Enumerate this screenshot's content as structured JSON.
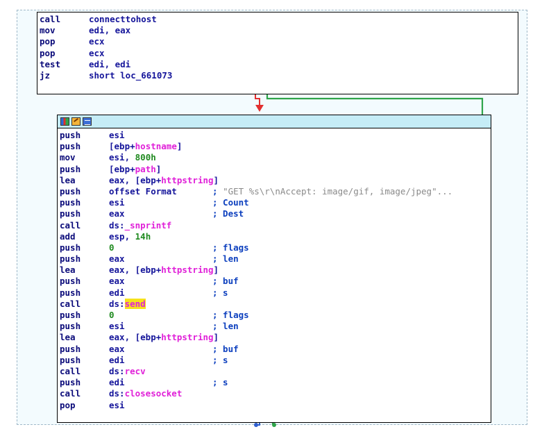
{
  "top_block": {
    "lines": [
      {
        "mn": "call",
        "ops": [
          {
            "t": "connecttohost",
            "c": "plain"
          }
        ]
      },
      {
        "mn": "mov",
        "ops": [
          {
            "t": "edi, eax",
            "c": "plain"
          }
        ]
      },
      {
        "mn": "pop",
        "ops": [
          {
            "t": "ecx",
            "c": "plain"
          }
        ]
      },
      {
        "mn": "pop",
        "ops": [
          {
            "t": "ecx",
            "c": "plain"
          }
        ]
      },
      {
        "mn": "test",
        "ops": [
          {
            "t": "edi, edi",
            "c": "plain"
          }
        ]
      },
      {
        "mn": "jz",
        "ops": [
          {
            "t": "short loc_661073",
            "c": "plain"
          }
        ]
      }
    ]
  },
  "main_block": {
    "lines": [
      {
        "mn": "push",
        "ops": [
          {
            "t": "esi",
            "c": "plain"
          }
        ]
      },
      {
        "mn": "push",
        "ops": [
          {
            "t": "[ebp+",
            "c": "plain"
          },
          {
            "t": "hostname",
            "c": "sym"
          },
          {
            "t": "]",
            "c": "plain"
          }
        ]
      },
      {
        "mn": "mov",
        "ops": [
          {
            "t": "esi, ",
            "c": "plain"
          },
          {
            "t": "800h",
            "c": "num"
          }
        ]
      },
      {
        "mn": "push",
        "ops": [
          {
            "t": "[ebp+",
            "c": "plain"
          },
          {
            "t": "path",
            "c": "sym"
          },
          {
            "t": "]",
            "c": "plain"
          }
        ]
      },
      {
        "mn": "lea",
        "ops": [
          {
            "t": "eax, [ebp+",
            "c": "plain"
          },
          {
            "t": "httpstring",
            "c": "sym"
          },
          {
            "t": "]",
            "c": "plain"
          }
        ]
      },
      {
        "mn": "push",
        "ops": [
          {
            "t": "offset Format",
            "c": "plain"
          }
        ],
        "cm": [
          {
            "t": "; ",
            "c": "plain"
          },
          {
            "t": "\"GET %s\\r\\nAccept: image/gif, image/jpeg\"...",
            "c": "str"
          }
        ]
      },
      {
        "mn": "push",
        "ops": [
          {
            "t": "esi",
            "c": "plain"
          }
        ],
        "cm": [
          {
            "t": "; Count",
            "c": "plain"
          }
        ]
      },
      {
        "mn": "push",
        "ops": [
          {
            "t": "eax",
            "c": "plain"
          }
        ],
        "cm": [
          {
            "t": "; Dest",
            "c": "plain"
          }
        ]
      },
      {
        "mn": "call",
        "ops": [
          {
            "t": "ds:",
            "c": "plain"
          },
          {
            "t": "_snprintf",
            "c": "sym"
          }
        ]
      },
      {
        "mn": "add",
        "ops": [
          {
            "t": "esp, ",
            "c": "plain"
          },
          {
            "t": "14h",
            "c": "num"
          }
        ]
      },
      {
        "mn": "push",
        "ops": [
          {
            "t": "0",
            "c": "num"
          }
        ],
        "cm": [
          {
            "t": "; flags",
            "c": "plain"
          }
        ]
      },
      {
        "mn": "push",
        "ops": [
          {
            "t": "eax",
            "c": "plain"
          }
        ],
        "cm": [
          {
            "t": "; len",
            "c": "plain"
          }
        ]
      },
      {
        "mn": "lea",
        "ops": [
          {
            "t": "eax, [ebp+",
            "c": "plain"
          },
          {
            "t": "httpstring",
            "c": "sym"
          },
          {
            "t": "]",
            "c": "plain"
          }
        ]
      },
      {
        "mn": "push",
        "ops": [
          {
            "t": "eax",
            "c": "plain"
          }
        ],
        "cm": [
          {
            "t": "; buf",
            "c": "plain"
          }
        ]
      },
      {
        "mn": "push",
        "ops": [
          {
            "t": "edi",
            "c": "plain"
          }
        ],
        "cm": [
          {
            "t": "; s",
            "c": "plain"
          }
        ]
      },
      {
        "mn": "call",
        "ops": [
          {
            "t": "ds:",
            "c": "plain"
          },
          {
            "t": "send",
            "c": "hl"
          }
        ]
      },
      {
        "mn": "push",
        "ops": [
          {
            "t": "0",
            "c": "num"
          }
        ],
        "cm": [
          {
            "t": "; flags",
            "c": "plain"
          }
        ]
      },
      {
        "mn": "push",
        "ops": [
          {
            "t": "esi",
            "c": "plain"
          }
        ],
        "cm": [
          {
            "t": "; len",
            "c": "plain"
          }
        ]
      },
      {
        "mn": "lea",
        "ops": [
          {
            "t": "eax, [ebp+",
            "c": "plain"
          },
          {
            "t": "httpstring",
            "c": "sym"
          },
          {
            "t": "]",
            "c": "plain"
          }
        ]
      },
      {
        "mn": "push",
        "ops": [
          {
            "t": "eax",
            "c": "plain"
          }
        ],
        "cm": [
          {
            "t": "; buf",
            "c": "plain"
          }
        ]
      },
      {
        "mn": "push",
        "ops": [
          {
            "t": "edi",
            "c": "plain"
          }
        ],
        "cm": [
          {
            "t": "; s",
            "c": "plain"
          }
        ]
      },
      {
        "mn": "call",
        "ops": [
          {
            "t": "ds:",
            "c": "plain"
          },
          {
            "t": "recv",
            "c": "sym"
          }
        ]
      },
      {
        "mn": "push",
        "ops": [
          {
            "t": "edi",
            "c": "plain"
          }
        ],
        "cm": [
          {
            "t": "; s",
            "c": "plain"
          }
        ]
      },
      {
        "mn": "call",
        "ops": [
          {
            "t": "ds:",
            "c": "plain"
          },
          {
            "t": "closesocket",
            "c": "sym"
          }
        ]
      },
      {
        "mn": "pop",
        "ops": [
          {
            "t": "esi",
            "c": "plain"
          }
        ]
      }
    ]
  },
  "title_icons": [
    "graph-view-icon",
    "edit-color-icon",
    "list-view-icon"
  ],
  "colors": {
    "canvas_bg": "#f3fbfe",
    "titlebar_bg": "#c5ecf6",
    "mnemonic": "#0b0b7a",
    "symbol": "#e020d8",
    "number": "#1f8a1f",
    "highlight": "#f6e21a",
    "edge_false": "#e23030",
    "edge_true": "#2fa44a",
    "edge_next": "#3060d0"
  }
}
